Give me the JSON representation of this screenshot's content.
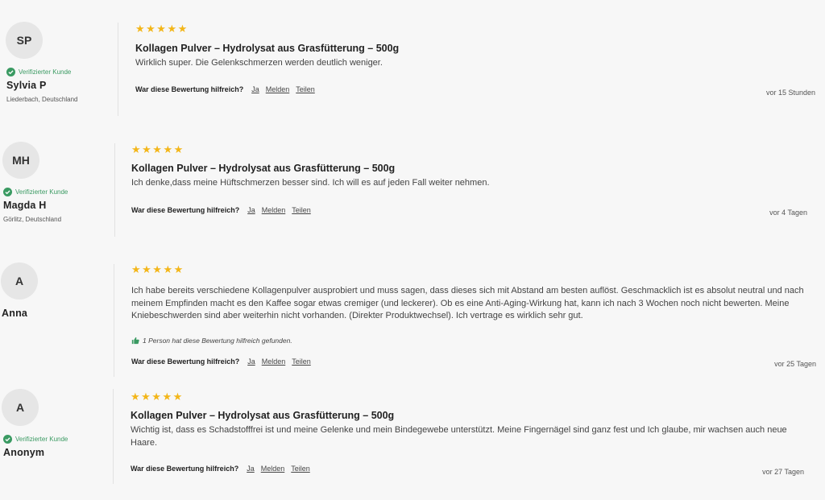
{
  "helpful_question": "War diese Bewertung hilfreich?",
  "links": {
    "yes": "Ja",
    "report": "Melden",
    "share": "Teilen"
  },
  "verified_label": "Verifizierter Kunde",
  "colors": {
    "stars": "#f3b619",
    "verified": "#3a9a62",
    "helpful_icon": "#3a9a62"
  },
  "reviews": [
    {
      "initials": "SP",
      "name": "Sylvia P",
      "location": "Liederbach, Deutschland",
      "rating": 5,
      "stars": "★★★★★",
      "title": "Kollagen Pulver – Hydrolysat aus Grasfütterung – 500g",
      "body": "Wirklich super. Die Gelenkschmerzen werden deutlich weniger.",
      "time": "vor 15 Stunden"
    },
    {
      "initials": "MH",
      "name": "Magda H",
      "location": "Görlitz, Deutschland",
      "rating": 5,
      "stars": "★★★★★",
      "title": "Kollagen Pulver – Hydrolysat aus Grasfütterung – 500g",
      "body": "Ich denke,dass meine Hüftschmerzen besser sind. Ich will es auf jeden Fall weiter nehmen.",
      "time": "vor 4 Tagen"
    },
    {
      "initials": "A",
      "name": "Anna",
      "rating": 5,
      "stars": "★★★★★",
      "body": "Ich habe bereits verschiedene Kollagenpulver ausprobiert und muss sagen, dass dieses sich mit Abstand am besten auflöst. Geschmacklich ist es absolut neutral und nach meinem Empfinden macht es den Kaffee sogar etwas cremiger (und leckerer). Ob es eine Anti-Aging-Wirkung hat, kann ich nach 3 Wochen noch nicht bewerten. Meine Kniebeschwerden sind aber weiterhin nicht vorhanden. (Direkter Produktwechsel). Ich vertrage es wirklich sehr gut.",
      "helpful_count": "1 Person hat diese Bewertung hilfreich gefunden.",
      "time": "vor 25 Tagen"
    },
    {
      "initials": "A",
      "name": "Anonym",
      "rating": 5,
      "stars": "★★★★★",
      "title": "Kollagen Pulver – Hydrolysat aus Grasfütterung – 500g",
      "body": "Wichtig ist, dass es Schadstofffrei ist und meine Gelenke und mein Bindegewebe unterstützt. Meine Fingernägel sind ganz fest und Ich glaube, mir wachsen auch neue Haare.",
      "time": "vor 27 Tagen"
    }
  ]
}
